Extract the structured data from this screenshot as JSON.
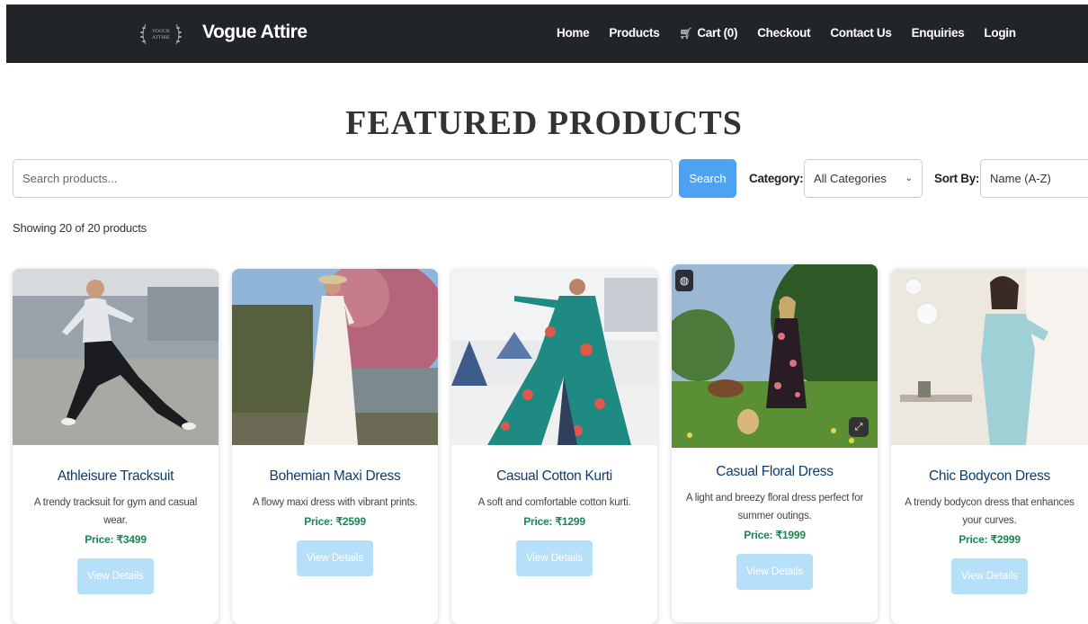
{
  "brand": {
    "name": "Vogue Attire",
    "logo_text": "VOGUE ATTIRE"
  },
  "nav": {
    "items": [
      {
        "label": "Home"
      },
      {
        "label": "Products"
      },
      {
        "label": "Cart (0)"
      },
      {
        "label": "Checkout"
      },
      {
        "label": "Contact Us"
      },
      {
        "label": "Enquiries"
      },
      {
        "label": "Login"
      }
    ],
    "cart_icon": "cart-icon"
  },
  "page": {
    "title": "FEATURED PRODUCTS"
  },
  "search": {
    "placeholder": "Search products...",
    "button_label": "Search"
  },
  "filters": {
    "category_label": "Category:",
    "category_value": "All Categories",
    "sort_label": "Sort By:",
    "sort_value": "Name (A-Z)"
  },
  "results": {
    "showing_text": "Showing 20 of 20 products"
  },
  "products": [
    {
      "name": "Athleisure Tracksuit",
      "description": "A trendy tracksuit for gym and casual wear.",
      "price": "Price: ₹3499",
      "button": "View Details"
    },
    {
      "name": "Bohemian Maxi Dress",
      "description": "A flowy maxi dress with vibrant prints.",
      "price": "Price: ₹2599",
      "button": "View Details"
    },
    {
      "name": "Casual Cotton Kurti",
      "description": "A soft and comfortable cotton kurti.",
      "price": "Price: ₹1299",
      "button": "View Details"
    },
    {
      "name": "Casual Floral Dress",
      "description": "A light and breezy floral dress perfect for summer outings.",
      "price": "Price: ₹1999",
      "button": "View Details"
    },
    {
      "name": "Chic Bodycon Dress",
      "description": "A trendy bodycon dress that enhances your curves.",
      "price": "Price: ₹2999",
      "button": "View Details"
    }
  ],
  "colors": {
    "navbar": "#212529",
    "search_button": "#4da3f2",
    "product_title": "#0d3c6e",
    "price": "#198754",
    "view_button": "#b6dffa"
  }
}
